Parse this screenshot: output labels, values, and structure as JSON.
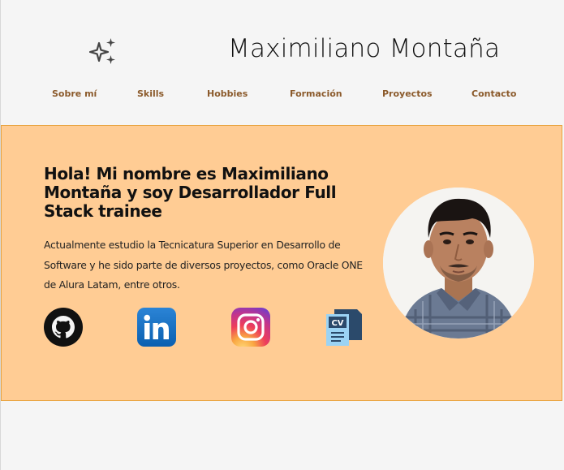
{
  "header": {
    "title": "Maximiliano Montaña",
    "logo_icon": "sparkles-icon"
  },
  "nav": {
    "items": [
      {
        "label": "Sobre mí"
      },
      {
        "label": "Skills"
      },
      {
        "label": "Hobbies"
      },
      {
        "label": "Formación"
      },
      {
        "label": "Proyectos"
      },
      {
        "label": "Contacto"
      }
    ]
  },
  "hero": {
    "title": "Hola! Mi nombre es Maximiliano Montaña y soy Desarrollador Full Stack trainee",
    "description": "Actualmente estudio la Tecnicatura Superior en Desarrollo de Software y he sido parte de diversos proyectos, como Oracle ONE de Alura Latam, entre otros.",
    "social": [
      {
        "name": "github-icon"
      },
      {
        "name": "linkedin-icon"
      },
      {
        "name": "instagram-icon"
      },
      {
        "name": "cv-icon",
        "text": "CV"
      }
    ],
    "photo": "profile-photo"
  },
  "colors": {
    "background": "#f5f5f5",
    "hero_background": "#ffcc94",
    "hero_border": "#e8a33e",
    "nav_link": "#8b5a2b",
    "text": "#111111"
  }
}
